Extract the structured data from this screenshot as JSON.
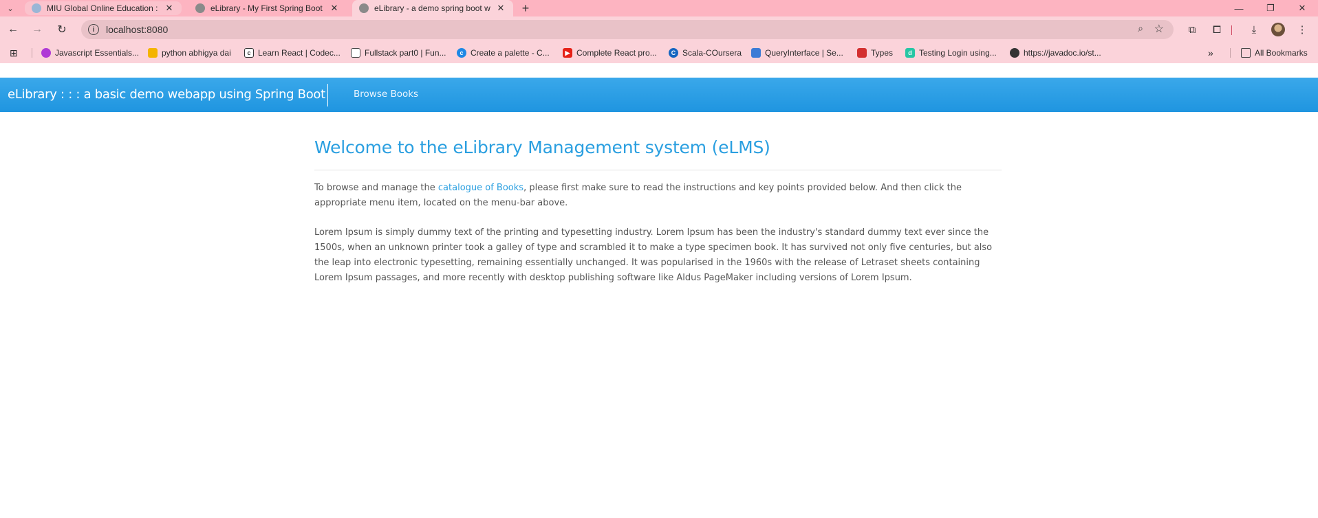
{
  "browser": {
    "tabs": [
      {
        "title": "MIU Global Online Education : G",
        "close": "✕",
        "active": false
      },
      {
        "title": "eLibrary - My First Spring Boot W",
        "close": "✕",
        "active": false
      },
      {
        "title": "eLibrary - a demo spring boot w",
        "close": "✕",
        "active": true
      }
    ],
    "new_tab": "+",
    "window_controls": {
      "minimize": "—",
      "restore": "❐",
      "close": "✕"
    },
    "url": "localhost:8080",
    "bookmarks": [
      {
        "label": "Javascript Essentials...",
        "color": "#b03ad6"
      },
      {
        "label": "python abhigya dai",
        "color": "#f4b400"
      },
      {
        "label": "Learn React | Codec...",
        "color": "#333333"
      },
      {
        "label": "Fullstack part0 | Fun...",
        "color": "#444444"
      },
      {
        "label": "Create a palette - C...",
        "color": "#1e88e5"
      },
      {
        "label": "Complete React pro...",
        "color": "#e62117"
      },
      {
        "label": "Scala-COursera",
        "color": "#1565c0"
      },
      {
        "label": "QueryInterface | Se...",
        "color": "#3c7bd6"
      },
      {
        "label": "Types",
        "color": "#d32f2f"
      },
      {
        "label": "Testing Login using...",
        "color": "#26c6a4"
      },
      {
        "label": "https://javadoc.io/st...",
        "color": "#333333"
      }
    ],
    "all_bookmarks": "All Bookmarks"
  },
  "navbar": {
    "brand": "eLibrary : : : a basic demo webapp using Spring Boot",
    "link": "Browse Books"
  },
  "main": {
    "title": "Welcome to the eLibrary Management system (eLMS)",
    "intro_before": "To browse and manage the ",
    "intro_link": "catalogue of Books",
    "intro_after": ", please first make sure to read the instructions and key points provided below. And then click the appropriate menu item, located on the menu-bar above.",
    "lorem": "Lorem Ipsum is simply dummy text of the printing and typesetting industry. Lorem Ipsum has been the industry's standard dummy text ever since the 1500s, when an unknown printer took a galley of type and scrambled it to make a type specimen book. It has survived not only five centuries, but also the leap into electronic typesetting, remaining essentially unchanged. It was popularised in the 1960s with the release of Letraset sheets containing Lorem Ipsum passages, and more recently with desktop publishing software like Aldus PageMaker including versions of Lorem Ipsum."
  }
}
